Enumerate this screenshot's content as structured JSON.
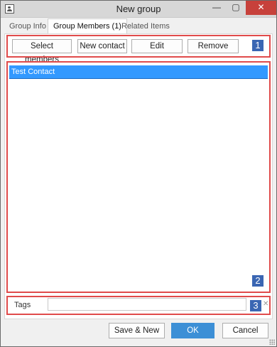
{
  "window": {
    "title": "New group",
    "minimize_glyph": "—",
    "maximize_glyph": "▢",
    "close_glyph": "✕",
    "close_color": "#c7413b"
  },
  "tabs": [
    {
      "label": "Group Info",
      "active": false
    },
    {
      "label": "Group Members (1)",
      "active": true
    },
    {
      "label": "Related Items",
      "active": false
    }
  ],
  "toolbar": {
    "select_members": "Select members",
    "new_contact": "New contact",
    "edit": "Edit",
    "remove": "Remove"
  },
  "members": [
    {
      "name": "Test Contact",
      "selected": true
    }
  ],
  "tags": {
    "label": "Tags",
    "value": "",
    "clear_glyph": "✕"
  },
  "annotations": {
    "box1": "1",
    "box2": "2",
    "box3": "3",
    "box_color": "#e04b4b",
    "badge_color": "#3a66b3"
  },
  "footer": {
    "save_new": "Save & New",
    "ok": "OK",
    "cancel": "Cancel",
    "ok_color": "#3c8fd6"
  },
  "selection_color": "#3399ff"
}
